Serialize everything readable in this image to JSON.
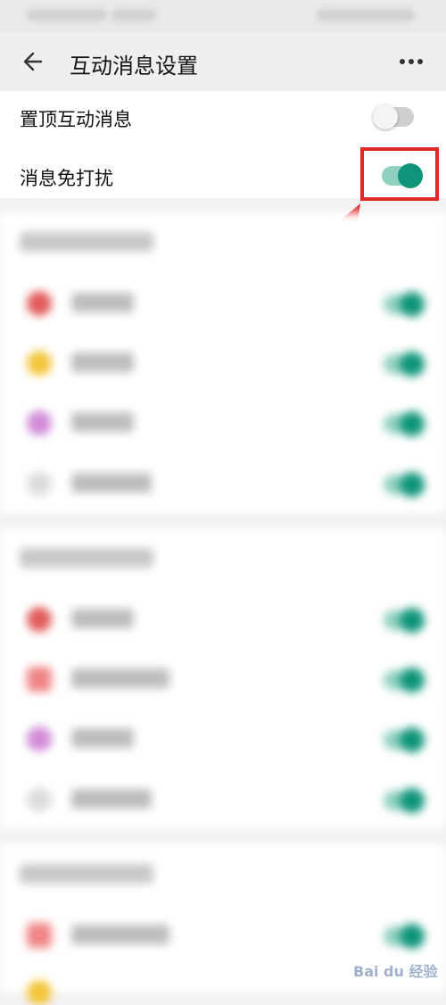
{
  "header": {
    "title": "互动消息设置",
    "back_icon": "arrow-left-icon",
    "more_icon": "more-horizontal-icon"
  },
  "settings": [
    {
      "label": "置顶互动消息",
      "enabled": false
    },
    {
      "label": "消息免打扰",
      "enabled": true,
      "highlighted": true
    }
  ],
  "colors": {
    "toggle_on": "#0e9479",
    "toggle_on_track": "#8fd0c0",
    "toggle_off_track": "#cfcfcf",
    "highlight": "#e02a2a"
  },
  "watermark": {
    "text": "Bai du 经验"
  }
}
